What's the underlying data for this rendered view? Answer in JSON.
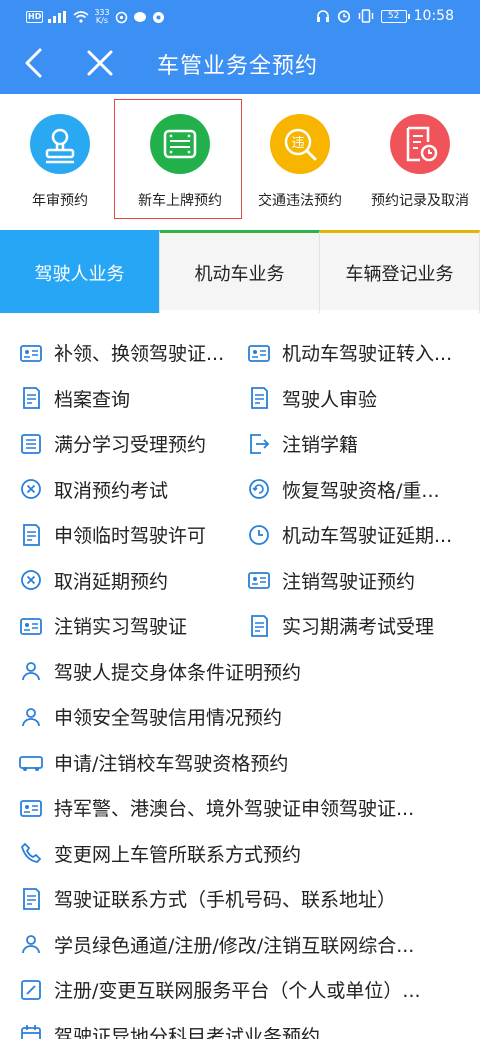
{
  "status_bar": {
    "hd": "HD",
    "speed": "333",
    "speed_unit": "K/s",
    "battery": "52",
    "time": "10:58"
  },
  "header": {
    "title": "车管业务全预约"
  },
  "quick_actions": [
    {
      "label": "年审预约",
      "color": "#2aa8f2",
      "icon": "stamp-icon"
    },
    {
      "label": "新车上牌预约",
      "color": "#22b04b",
      "icon": "license-plate-icon"
    },
    {
      "label": "交通违法预约",
      "color": "#f7b500",
      "icon": "violation-search-icon"
    },
    {
      "label": "预约记录及取消",
      "color": "#f0545a",
      "icon": "record-clock-icon"
    }
  ],
  "tabs": [
    {
      "label": "驾驶人业务"
    },
    {
      "label": "机动车业务"
    },
    {
      "label": "车辆登记业务"
    }
  ],
  "services": {
    "grid": [
      [
        "补领、换领驾驶证...",
        "机动车驾驶证转入..."
      ],
      [
        "档案查询",
        "驾驶人审验"
      ],
      [
        "满分学习受理预约",
        "注销学籍"
      ],
      [
        "取消预约考试",
        "恢复驾驶资格/重..."
      ],
      [
        "申领临时驾驶许可",
        "机动车驾驶证延期..."
      ],
      [
        "取消延期预约",
        "注销驾驶证预约"
      ],
      [
        "注销实习驾驶证",
        "实习期满考试受理"
      ]
    ],
    "full": [
      "驾驶人提交身体条件证明预约",
      "申领安全驾驶信用情况预约",
      "申请/注销校车驾驶资格预约",
      "持军警、港澳台、境外驾驶证申领驾驶证...",
      "变更网上车管所联系方式预约",
      "驾驶证联系方式（手机号码、联系地址）",
      "学员绿色通道/注册/修改/注销互联网综合...",
      "注册/变更互联网服务平台（个人或单位）...",
      "驾驶证异地分科目考试业务预约"
    ]
  },
  "colors": {
    "primary": "#3c8ff3",
    "tab_active": "#27a6f5",
    "icon_blue": "#2a7fd8",
    "highlight_border": "#e24a3f"
  }
}
